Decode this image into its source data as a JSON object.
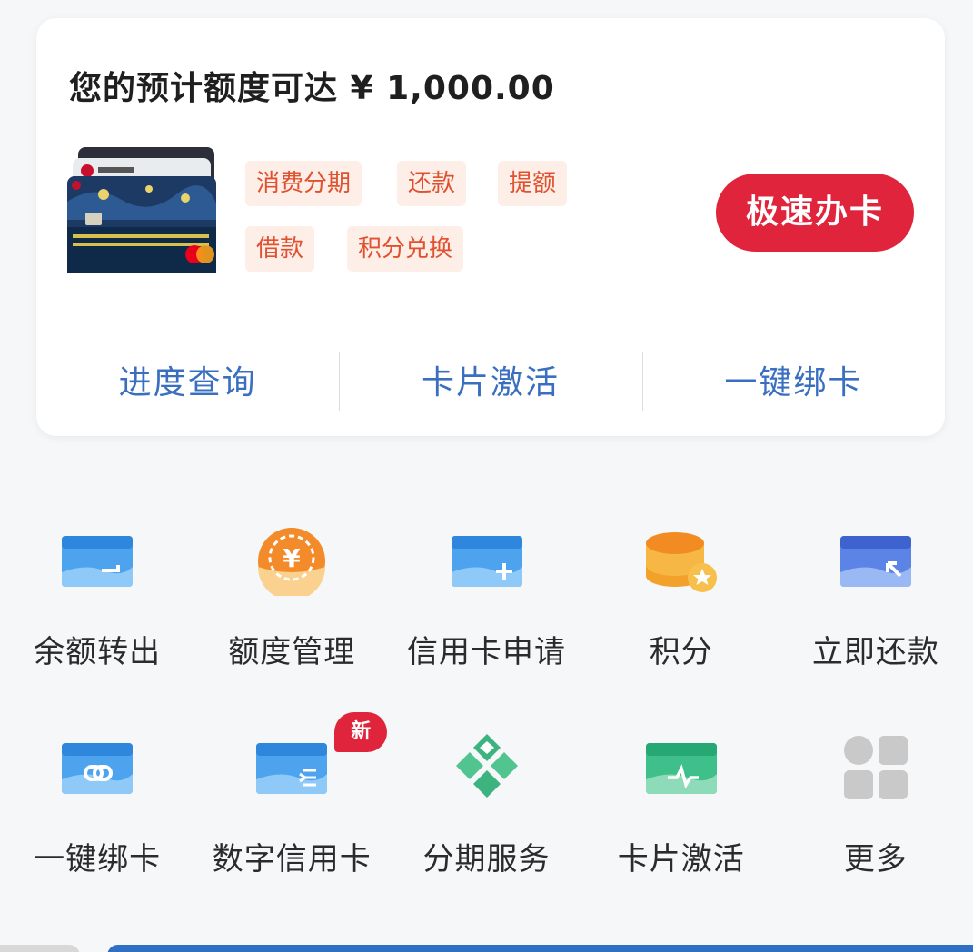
{
  "quota": {
    "text": "您的预计额度可达 ¥ 1,000.00"
  },
  "tags": [
    "消费分期",
    "还款",
    "提额",
    "借款",
    "积分兑换"
  ],
  "apply_button": "极速办卡",
  "actions": [
    "进度查询",
    "卡片激活",
    "一键绑卡"
  ],
  "grid": {
    "row1": [
      {
        "label": "余额转出",
        "icon": "card-transfer-icon"
      },
      {
        "label": "额度管理",
        "icon": "yuan-coin-icon"
      },
      {
        "label": "信用卡申请",
        "icon": "card-add-icon"
      },
      {
        "label": "积分",
        "icon": "points-stack-icon"
      },
      {
        "label": "立即还款",
        "icon": "card-repay-icon"
      }
    ],
    "row2": [
      {
        "label": "一键绑卡",
        "icon": "card-link-icon"
      },
      {
        "label": "数字信用卡",
        "icon": "digital-card-icon",
        "badge": "新"
      },
      {
        "label": "分期服务",
        "icon": "installment-diamond-icon"
      },
      {
        "label": "卡片激活",
        "icon": "card-activate-icon"
      },
      {
        "label": "更多",
        "icon": "more-grid-icon"
      }
    ]
  },
  "colors": {
    "accent_red": "#e0243b",
    "link_blue": "#3a6fc0",
    "tag_bg": "#fdeee8",
    "tag_text": "#e0512f"
  }
}
